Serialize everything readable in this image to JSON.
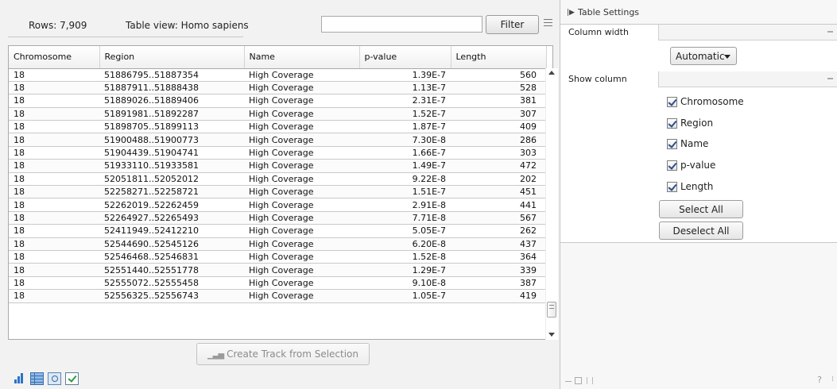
{
  "top_bar": {
    "rows_label": "Rows: 7,909",
    "table_view_label": "Table view: Homo sapiens",
    "filter_value": "",
    "filter_button": "Filter"
  },
  "table": {
    "columns": [
      "Chromosome",
      "Region",
      "Name",
      "p-value",
      "Length"
    ],
    "rows": [
      [
        "18",
        "51886795..51887354",
        "High Coverage",
        "1.39E-7",
        "560"
      ],
      [
        "18",
        "51887911..51888438",
        "High Coverage",
        "1.13E-7",
        "528"
      ],
      [
        "18",
        "51889026..51889406",
        "High Coverage",
        "2.31E-7",
        "381"
      ],
      [
        "18",
        "51891981..51892287",
        "High Coverage",
        "1.52E-7",
        "307"
      ],
      [
        "18",
        "51898705..51899113",
        "High Coverage",
        "1.87E-7",
        "409"
      ],
      [
        "18",
        "51900488..51900773",
        "High Coverage",
        "7.30E-8",
        "286"
      ],
      [
        "18",
        "51904439..51904741",
        "High Coverage",
        "1.66E-7",
        "303"
      ],
      [
        "18",
        "51933110..51933581",
        "High Coverage",
        "1.49E-7",
        "472"
      ],
      [
        "18",
        "52051811..52052012",
        "High Coverage",
        "9.22E-8",
        "202"
      ],
      [
        "18",
        "52258271..52258721",
        "High Coverage",
        "1.51E-7",
        "451"
      ],
      [
        "18",
        "52262019..52262459",
        "High Coverage",
        "2.91E-8",
        "441"
      ],
      [
        "18",
        "52264927..52265493",
        "High Coverage",
        "7.71E-8",
        "567"
      ],
      [
        "18",
        "52411949..52412210",
        "High Coverage",
        "5.05E-7",
        "262"
      ],
      [
        "18",
        "52544690..52545126",
        "High Coverage",
        "6.20E-8",
        "437"
      ],
      [
        "18",
        "52546468..52546831",
        "High Coverage",
        "1.52E-8",
        "364"
      ],
      [
        "18",
        "52551440..52551778",
        "High Coverage",
        "1.29E-7",
        "339"
      ],
      [
        "18",
        "52555072..52555458",
        "High Coverage",
        "9.10E-8",
        "387"
      ],
      [
        "18",
        "52556325..52556743",
        "High Coverage",
        "1.05E-7",
        "419"
      ]
    ]
  },
  "create_track_button": "Create Track from Selection",
  "view_switcher": [
    "bars-icon",
    "table-icon",
    "graphics-icon",
    "check-icon"
  ],
  "settings": {
    "header": "Table Settings",
    "column_width_label": "Column width",
    "column_width_value": "Automatic",
    "show_column_label": "Show column",
    "show_columns": [
      "Chromosome",
      "Region",
      "Name",
      "p-value",
      "Length"
    ],
    "select_all": "Select All",
    "deselect_all": "Deselect All",
    "help": "?"
  }
}
